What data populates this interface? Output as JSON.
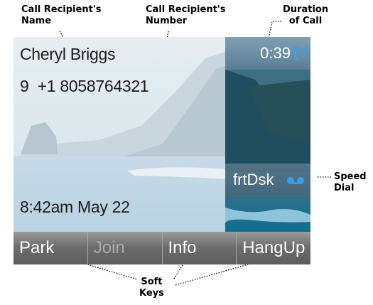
{
  "callouts": {
    "recipient_name": "Call Recipient's\nName",
    "recipient_number": "Call Recipient's\nNumber",
    "duration": "Duration\nof Call",
    "speed_dial": "Speed\nDial",
    "soft_keys": "Soft\nKeys"
  },
  "call": {
    "recipient_name": "Cheryl Briggs",
    "recipient_number": "9  +1 8058764321",
    "duration": "0:39",
    "datetime": "8:42am May 22"
  },
  "speed_dial": {
    "label": "frtDsk",
    "icon": "voicemail-icon"
  },
  "softkeys": [
    {
      "label": "Park",
      "enabled": true
    },
    {
      "label": "Join",
      "enabled": false
    },
    {
      "label": "Info",
      "enabled": true
    },
    {
      "label": "HangUp",
      "enabled": true
    }
  ],
  "colors": {
    "accent": "#3a9fe8",
    "softkey_bar": "#6e6e6e",
    "disabled_text": "#a9a9a9"
  }
}
